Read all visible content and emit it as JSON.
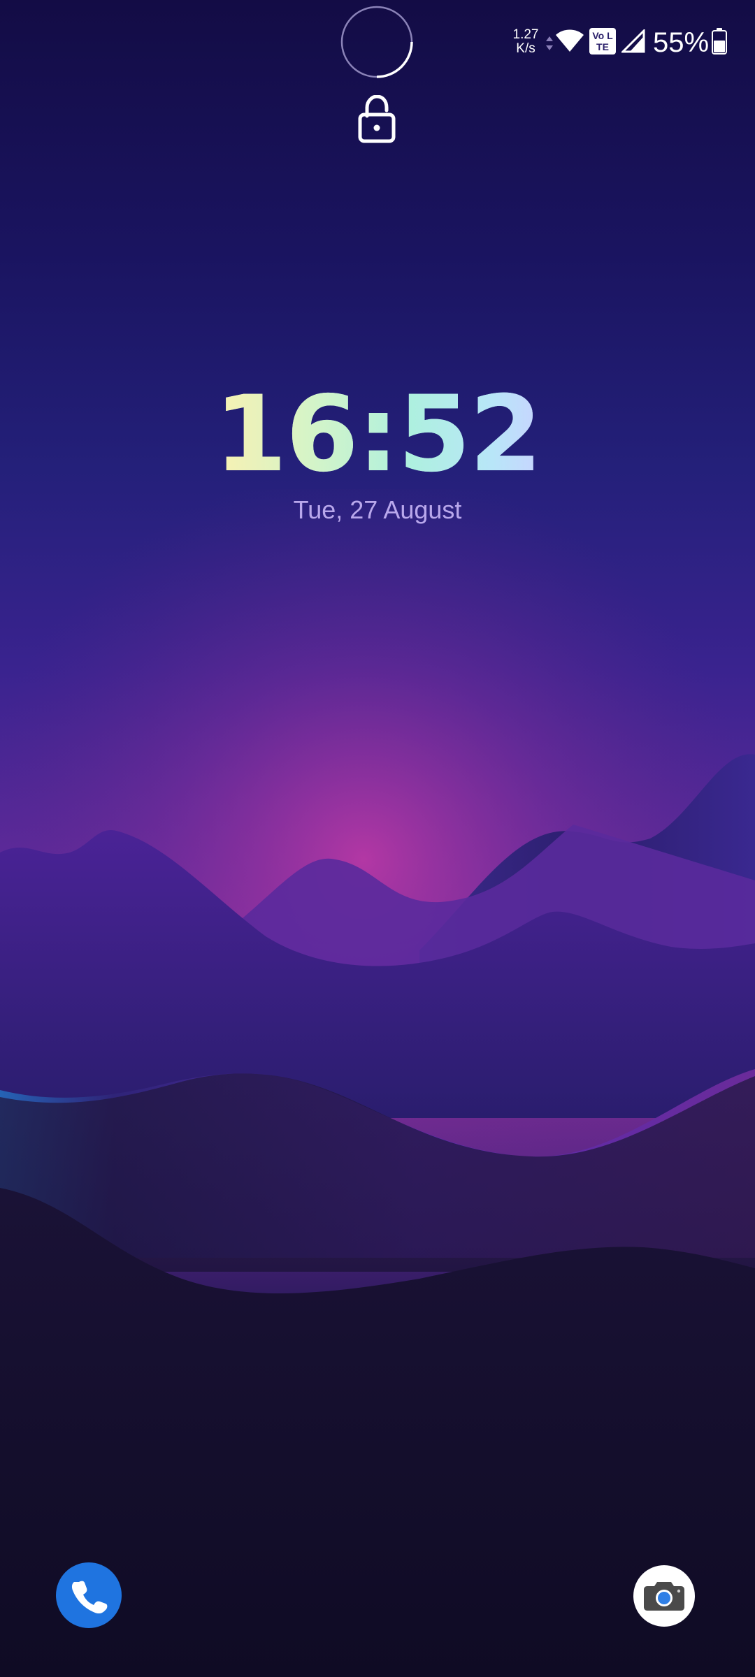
{
  "status_bar": {
    "net_speed_value": "1.27",
    "net_speed_unit": "K/s",
    "volte_label": "Vo LTE",
    "battery_percent": "55%",
    "icons": [
      "data-activity-icon",
      "wifi-icon",
      "volte-icon",
      "cell-signal-icon",
      "battery-icon"
    ]
  },
  "lockscreen": {
    "time": "16:52",
    "date": "Tue, 27 August",
    "icons": [
      "fingerprint-ring-icon",
      "lock-icon"
    ]
  },
  "shortcuts": {
    "left": {
      "icon": "phone-icon",
      "color": "#1f74e0"
    },
    "right": {
      "icon": "camera-icon",
      "color": "#ffffff"
    }
  },
  "colors": {
    "clock_gradient": [
      "#f9f1b2",
      "#aef0df",
      "#c8d4ff"
    ],
    "date_text": "#b9a8ec",
    "sky_top": "#130c45",
    "sky_glow": "#8a2f9c",
    "ground": "#0f0b24"
  }
}
